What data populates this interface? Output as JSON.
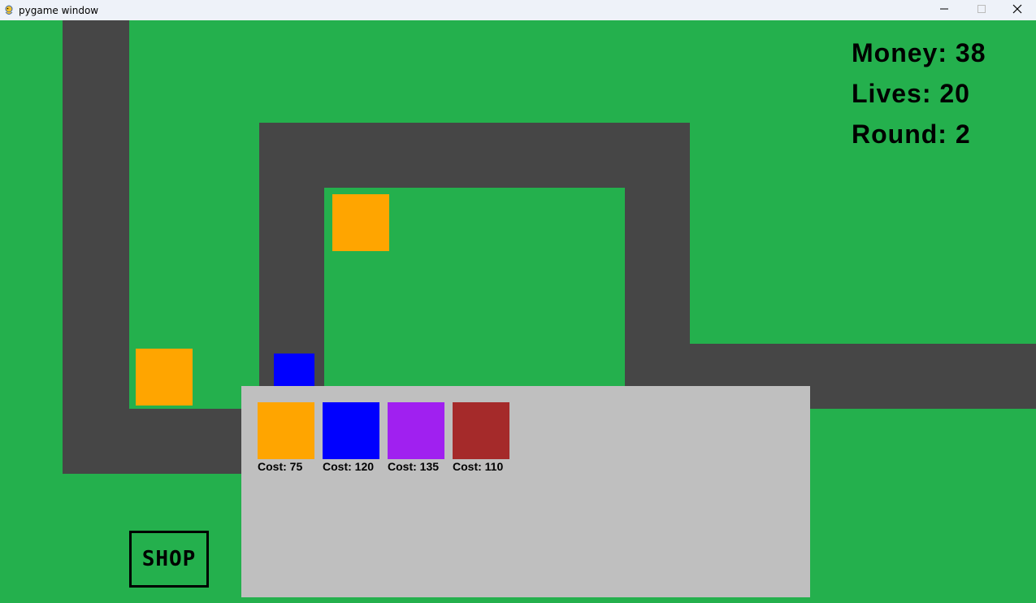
{
  "window": {
    "title": "pygame window",
    "icon": "pygame-snake-icon",
    "controls": [
      "minimize-icon",
      "maximize-icon",
      "close-icon"
    ]
  },
  "hud": {
    "money": "Money: 38",
    "lives": "Lives: 20",
    "round": "Round: 2"
  },
  "colors": {
    "grass": "#24b04d",
    "path": "#464646",
    "shop_panel": "#bfbfbf",
    "tower_orange": "#ffa500",
    "tower_blue": "#0000ff",
    "tower_purple": "#a020f0",
    "tower_red": "#a52a2a"
  },
  "placed_towers": [
    {
      "type": "orange",
      "color": "#ffa500"
    },
    {
      "type": "orange",
      "color": "#ffa500"
    },
    {
      "type": "blue",
      "color": "#0000ff"
    }
  ],
  "shop": {
    "items": [
      {
        "color": "#ffa500",
        "cost": "Cost: 75"
      },
      {
        "color": "#0000ff",
        "cost": "Cost: 120"
      },
      {
        "color": "#a020f0",
        "cost": "Cost: 135"
      },
      {
        "color": "#a52a2a",
        "cost": "Cost: 110"
      }
    ],
    "button_label": "SHOP"
  }
}
